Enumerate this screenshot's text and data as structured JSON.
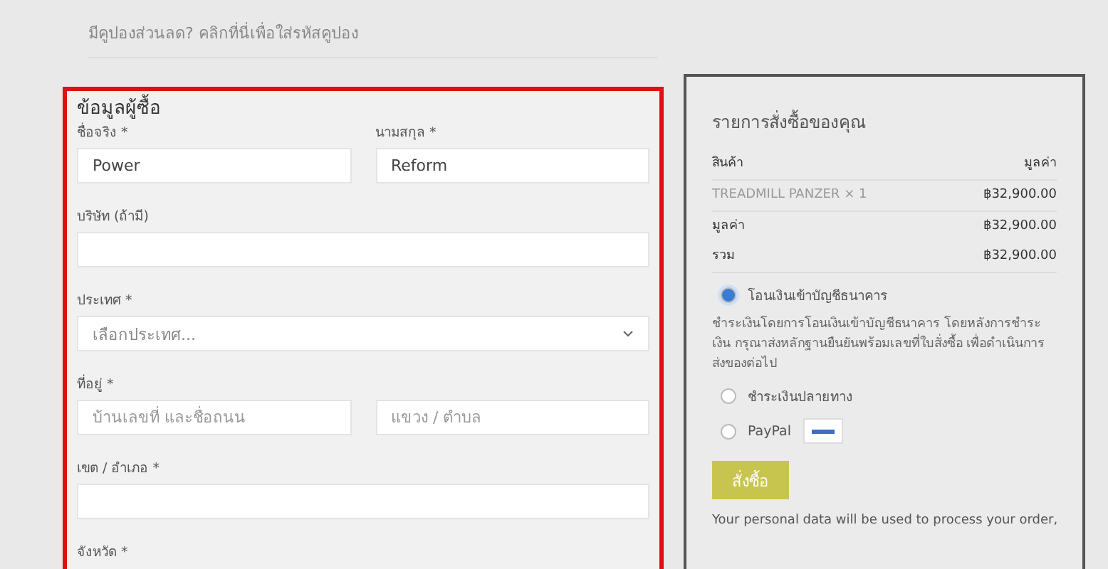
{
  "coupon_notice": "มีคูปองส่วนลด? คลิกที่นี่เพื่อใส่รหัสคูปอง",
  "billing": {
    "title": "ข้อมูลผู้ซื้อ",
    "first_name": {
      "label": "ชื่อจริง *",
      "value": "Power"
    },
    "last_name": {
      "label": "นามสกุล *",
      "value": "Reform"
    },
    "company": {
      "label": "บริษัท (ถ้ามี)"
    },
    "country": {
      "label": "ประเทศ *",
      "placeholder": "เลือกประเทศ..."
    },
    "address": {
      "label": "ที่อยู่ *",
      "placeholder_1": "บ้านเลขที่ และชื่อถนน",
      "placeholder_2": "แขวง / ตำบล"
    },
    "district": {
      "label": "เขต / อำเภอ *"
    },
    "province": {
      "label": "จังหวัด *"
    }
  },
  "order": {
    "title": "รายการสั่งซื้อของคุณ",
    "columns": [
      "สินค้า",
      "มูลค่า"
    ],
    "items": [
      {
        "name": "TREADMILL PANZER",
        "qty": "× 1",
        "price": "฿32,900.00"
      }
    ],
    "subtotal": {
      "label": "มูลค่า",
      "value": "฿32,900.00"
    },
    "total": {
      "label": "รวม",
      "value": "฿32,900.00"
    },
    "payments": [
      {
        "kind": "text",
        "label": "โอนเงินเข้าบัญชีธนาคาร",
        "selected": true,
        "description": "ชำระเงินโดยการโอนเงินเข้าบัญชีธนาคาร โดยหลังการชำระเงิน กรุณาส่งหลักฐานยืนยันพร้อมเลขที่ใบสั่งซื้อ เพื่อดำเนินการส่งของต่อไป"
      },
      {
        "kind": "text",
        "label": "ชำระเงินปลายทาง",
        "selected": false
      },
      {
        "kind": "logo",
        "label": "PayPal",
        "selected": false
      }
    ],
    "button": "สั่งซื้อ",
    "privacy": "Your personal data will be used to process your order,"
  }
}
